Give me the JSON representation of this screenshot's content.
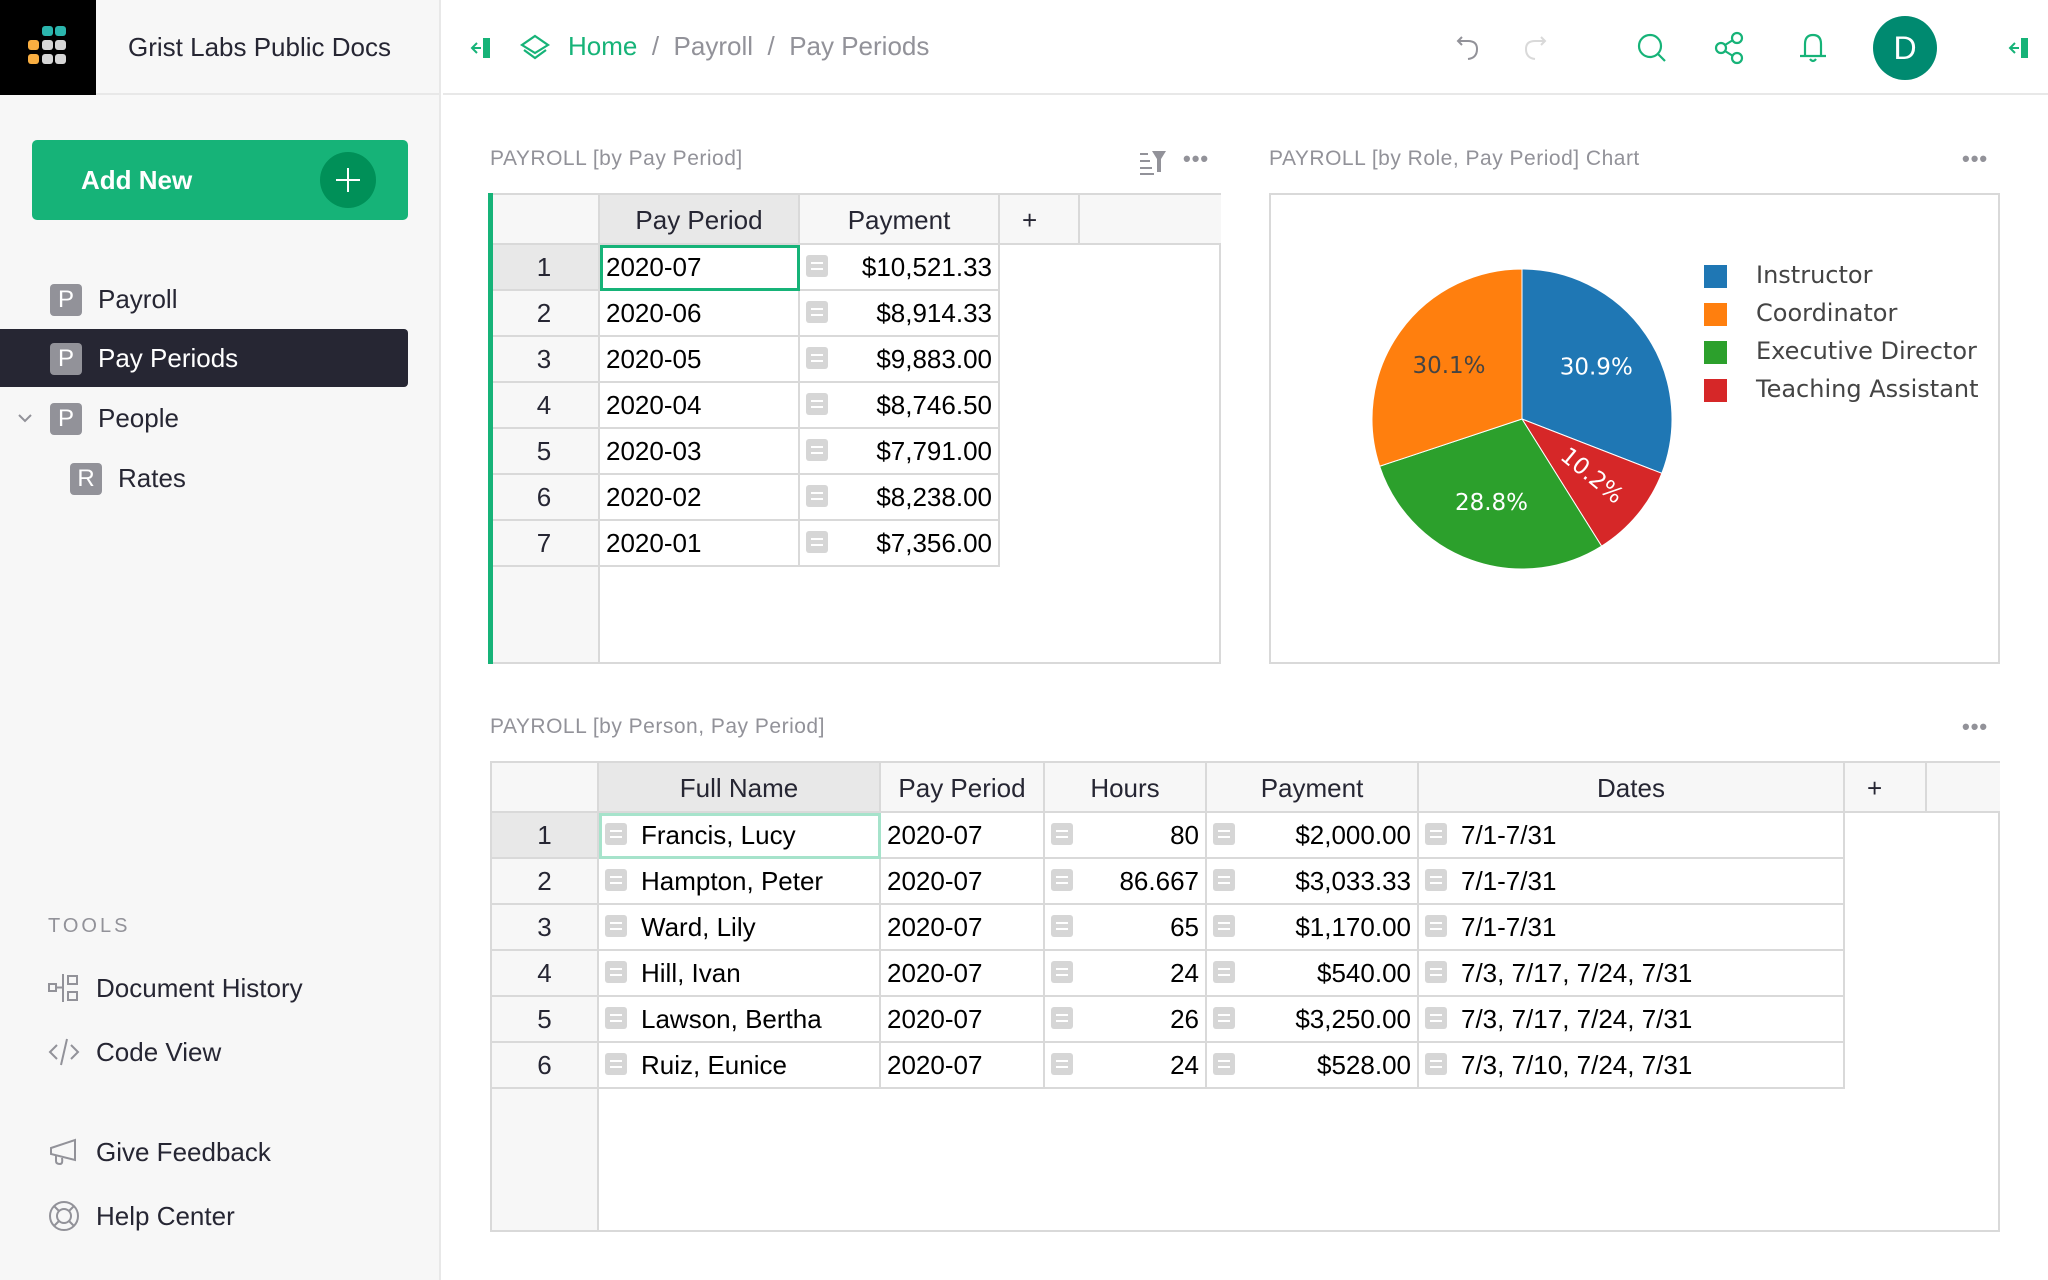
{
  "org": {
    "name": "Grist Labs Public Docs"
  },
  "sidebar": {
    "add_new_label": "Add New",
    "pages": [
      {
        "initial": "P",
        "label": "Payroll",
        "selected": false
      },
      {
        "initial": "P",
        "label": "Pay Periods",
        "selected": true
      },
      {
        "initial": "P",
        "label": "People",
        "selected": false,
        "expanded": true
      },
      {
        "initial": "R",
        "label": "Rates",
        "selected": false,
        "child": true
      }
    ],
    "tools_label": "TOOLS",
    "tools": [
      {
        "icon": "document-history-icon",
        "label": "Document History"
      },
      {
        "icon": "code-view-icon",
        "label": "Code View"
      }
    ],
    "footer": [
      {
        "icon": "megaphone-icon",
        "label": "Give Feedback"
      },
      {
        "icon": "lifebuoy-icon",
        "label": "Help Center"
      }
    ]
  },
  "topbar": {
    "breadcrumb": {
      "home": "Home",
      "sep": "/",
      "doc": "Payroll",
      "page": "Pay Periods"
    },
    "avatar_initial": "D",
    "icons": [
      "collapse-left-panel-icon",
      "undo-icon",
      "redo-icon",
      "search-icon",
      "share-icon",
      "bell-icon",
      "collapse-right-panel-icon"
    ]
  },
  "colors": {
    "accent": "#16b378",
    "avatar": "#008a70",
    "selected_page": "#262633"
  },
  "section_periods": {
    "title": "PAYROLL [by Pay Period]",
    "columns": [
      "Pay Period",
      "Payment",
      "+"
    ],
    "rows": [
      {
        "n": "1",
        "period": "2020-07",
        "payment": "$10,521.33"
      },
      {
        "n": "2",
        "period": "2020-06",
        "payment": "$8,914.33"
      },
      {
        "n": "3",
        "period": "2020-05",
        "payment": "$9,883.00"
      },
      {
        "n": "4",
        "period": "2020-04",
        "payment": "$8,746.50"
      },
      {
        "n": "5",
        "period": "2020-03",
        "payment": "$7,791.00"
      },
      {
        "n": "6",
        "period": "2020-02",
        "payment": "$8,238.00"
      },
      {
        "n": "7",
        "period": "2020-01",
        "payment": "$7,356.00"
      }
    ]
  },
  "section_chart": {
    "title": "PAYROLL [by Role, Pay Period] Chart"
  },
  "chart_data": {
    "type": "pie",
    "title": "PAYROLL [by Role, Pay Period] Chart",
    "legend_position": "right",
    "direction": "clockwise",
    "start_angle": "top",
    "slices": [
      {
        "label": "Instructor",
        "percent": 30.9,
        "text": "30.9%",
        "color": "#1f77b4"
      },
      {
        "label": "Teaching Assistant",
        "percent": 10.2,
        "text": "10.2%",
        "color": "#d62728"
      },
      {
        "label": "Executive Director",
        "percent": 28.8,
        "text": "28.8%",
        "color": "#2ca02c"
      },
      {
        "label": "Coordinator",
        "percent": 30.1,
        "text": "30.1%",
        "color": "#ff7f0e"
      }
    ],
    "legend": [
      {
        "label": "Instructor",
        "color": "#1f77b4"
      },
      {
        "label": "Coordinator",
        "color": "#ff7f0e"
      },
      {
        "label": "Executive Director",
        "color": "#2ca02c"
      },
      {
        "label": "Teaching Assistant",
        "color": "#d62728"
      }
    ]
  },
  "section_people": {
    "title": "PAYROLL [by Person, Pay Period]",
    "columns": [
      "Full Name",
      "Pay Period",
      "Hours",
      "Payment",
      "Dates",
      "+"
    ],
    "rows": [
      {
        "n": "1",
        "name": "Francis, Lucy",
        "period": "2020-07",
        "hours": "80",
        "payment": "$2,000.00",
        "dates": "7/1-7/31"
      },
      {
        "n": "2",
        "name": "Hampton, Peter",
        "period": "2020-07",
        "hours": "86.667",
        "payment": "$3,033.33",
        "dates": "7/1-7/31"
      },
      {
        "n": "3",
        "name": "Ward, Lily",
        "period": "2020-07",
        "hours": "65",
        "payment": "$1,170.00",
        "dates": "7/1-7/31"
      },
      {
        "n": "4",
        "name": "Hill, Ivan",
        "period": "2020-07",
        "hours": "24",
        "payment": "$540.00",
        "dates": "7/3, 7/17, 7/24, 7/31"
      },
      {
        "n": "5",
        "name": "Lawson, Bertha",
        "period": "2020-07",
        "hours": "26",
        "payment": "$3,250.00",
        "dates": "7/3, 7/17, 7/24, 7/31"
      },
      {
        "n": "6",
        "name": "Ruiz, Eunice",
        "period": "2020-07",
        "hours": "24",
        "payment": "$528.00",
        "dates": "7/3, 7/10, 7/24, 7/31"
      }
    ]
  }
}
